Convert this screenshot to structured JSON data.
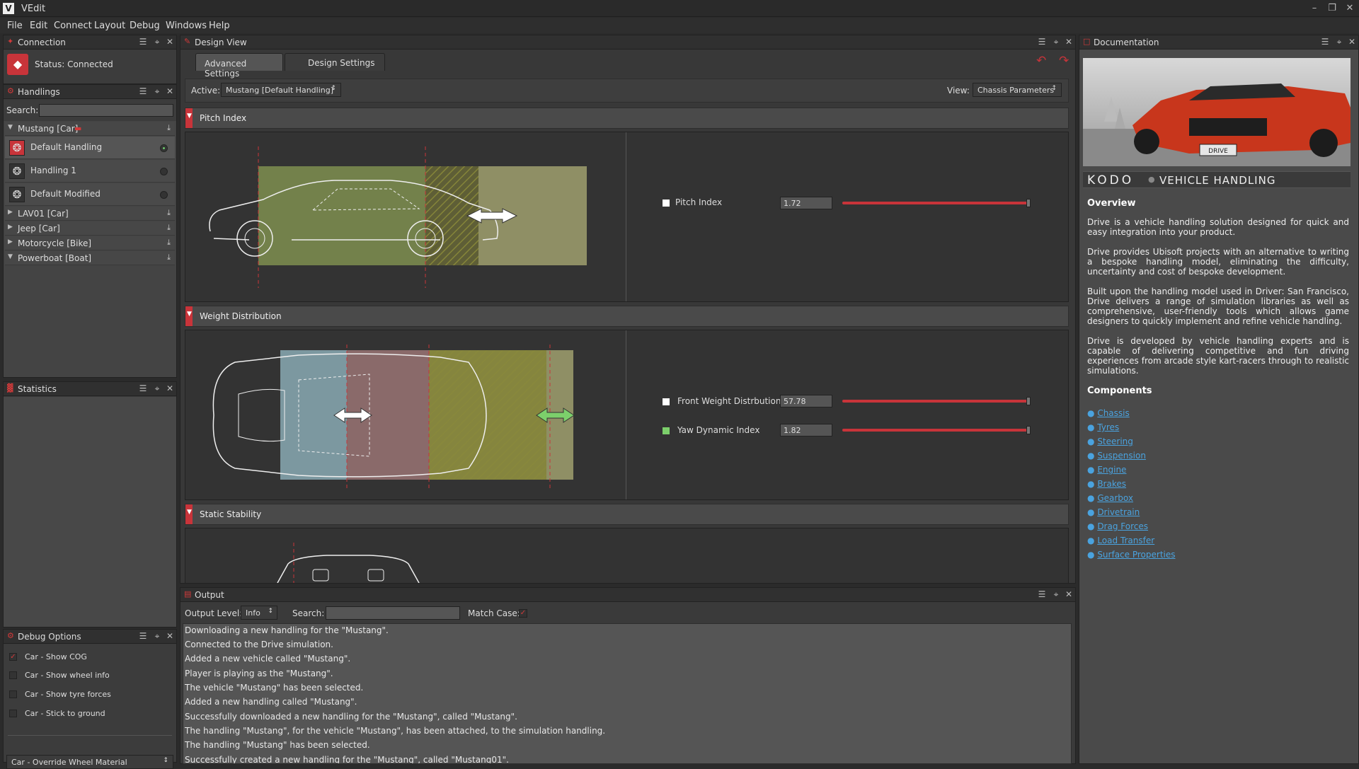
{
  "app": {
    "title": "VEdit",
    "logo": "V"
  },
  "menu": [
    "File",
    "Edit",
    "Connect",
    "Layout",
    "Debug",
    "Windows",
    "Help"
  ],
  "connection": {
    "title": "Connection",
    "status": "Status: Connected"
  },
  "handlings": {
    "title": "Handlings",
    "search_label": "Search:",
    "search_value": "",
    "groups": [
      {
        "label": "Mustang [Car]",
        "expanded": true
      },
      {
        "label": "LAV01 [Car]"
      },
      {
        "label": "Jeep [Car]"
      },
      {
        "label": "Motorcycle [Bike]"
      },
      {
        "label": "Powerboat [Boat]"
      }
    ],
    "items": [
      "Default Handling",
      "Handling 1",
      "Default Modified"
    ]
  },
  "statistics": {
    "title": "Statistics"
  },
  "debug": {
    "title": "Debug Options",
    "options": [
      "Car - Show COG",
      "Car - Show wheel info",
      "Car - Show tyre forces",
      "Car - Stick to ground"
    ],
    "checked": [
      true,
      false,
      false,
      false
    ],
    "dropdown": "Car - Override Wheel Material"
  },
  "design": {
    "title": "Design View",
    "tabs": [
      "Advanced Settings",
      "Design Settings"
    ],
    "active_label": "Active:",
    "active_value": "Mustang [Default Handling]",
    "view_label": "View:",
    "view_value": "Chassis Parameters",
    "sections": [
      {
        "title": "Pitch Index",
        "params": [
          {
            "label": "Pitch Index",
            "value": "1.72",
            "fraction": 0.98,
            "color": "#ffffff"
          }
        ]
      },
      {
        "title": "Weight Distribution",
        "params": [
          {
            "label": "Front Weight Distrbution",
            "value": "57.78",
            "fraction": 0.98,
            "color": "#ffffff"
          },
          {
            "label": "Yaw Dynamic Index",
            "value": "1.82",
            "fraction": 0.98,
            "color": "#7ccf6b"
          }
        ]
      },
      {
        "title": "Static Stability",
        "params": []
      }
    ]
  },
  "documentation": {
    "title": "Documentation",
    "brand": "KODO",
    "brand_sub": "VEHICLE HANDLING",
    "plate": "DRIVE",
    "overview_heading": "Overview",
    "paragraphs": [
      "Drive is a vehicle handling solution designed for quick and easy integration into your product.",
      "Drive provides Ubisoft projects with an alternative to writing a bespoke handling model, eliminating the difficulty, uncertainty and cost of bespoke development.",
      "Built upon the handling model used in Driver: San Francisco, Drive delivers a range of simulation libraries as well as comprehensive, user-friendly tools which allows game designers to quickly implement and refine vehicle handling.",
      "Drive is developed by vehicle handling experts and is capable of delivering competitive and fun driving experiences from arcade style kart-racers through to realistic simulations."
    ],
    "components_heading": "Components",
    "components": [
      "Chassis",
      "Tyres",
      "Steering",
      "Suspension",
      "Engine",
      "Brakes",
      "Gearbox",
      "Drivetrain",
      "Drag Forces",
      "Load Transfer",
      "Surface Properties"
    ]
  },
  "output": {
    "title": "Output",
    "level_label": "Output Level:",
    "level_value": "Info",
    "search_label": "Search:",
    "search_value": "",
    "match_label": "Match Case:",
    "lines": [
      "Downloading a new handling for the \"Mustang\".",
      "Connected to the Drive simulation.",
      "Added a new vehicle called \"Mustang\".",
      "Player is playing as the \"Mustang\".",
      "The vehicle \"Mustang\" has been selected.",
      "Added a new handling called \"Mustang\".",
      "Successfully downloaded a new handling for the \"Mustang\", called \"Mustang\".",
      "The handling \"Mustang\", for the vehicle \"Mustang\", has been attached, to the simulation handling.",
      "The handling \"Mustang\" has been selected.",
      "Successfully created a new handling for the \"Mustang\", called \"Mustang01\"."
    ]
  }
}
